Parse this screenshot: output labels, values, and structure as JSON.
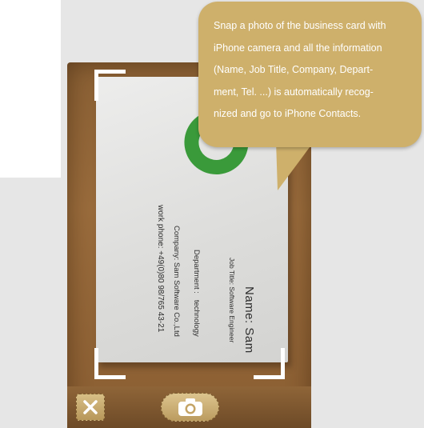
{
  "tooltip": {
    "line1": "Snap a photo of the business card with",
    "line2": "iPhone camera and all the information",
    "line3": "(Name, Job Title, Company, Depart-",
    "line4": "ment, Tel. ...) is automatically recog-",
    "line5": "nized and go to iPhone Contacts."
  },
  "card": {
    "name": "Name: Sam",
    "job_title": "Job Title: Software Engineer",
    "department": "Department :   technology",
    "company": "Company: Sam Software Co.,Ltd",
    "phone": "work phone: +49(0)80 98/765 43-21",
    "logo_color": "#3a9a3a"
  },
  "toolbar": {
    "close_icon": "close-icon",
    "camera_icon": "camera-icon"
  },
  "colors": {
    "bubble": "#ceb06b",
    "frame_brown": "#8a6034",
    "button_tan": "#c9ad72"
  }
}
